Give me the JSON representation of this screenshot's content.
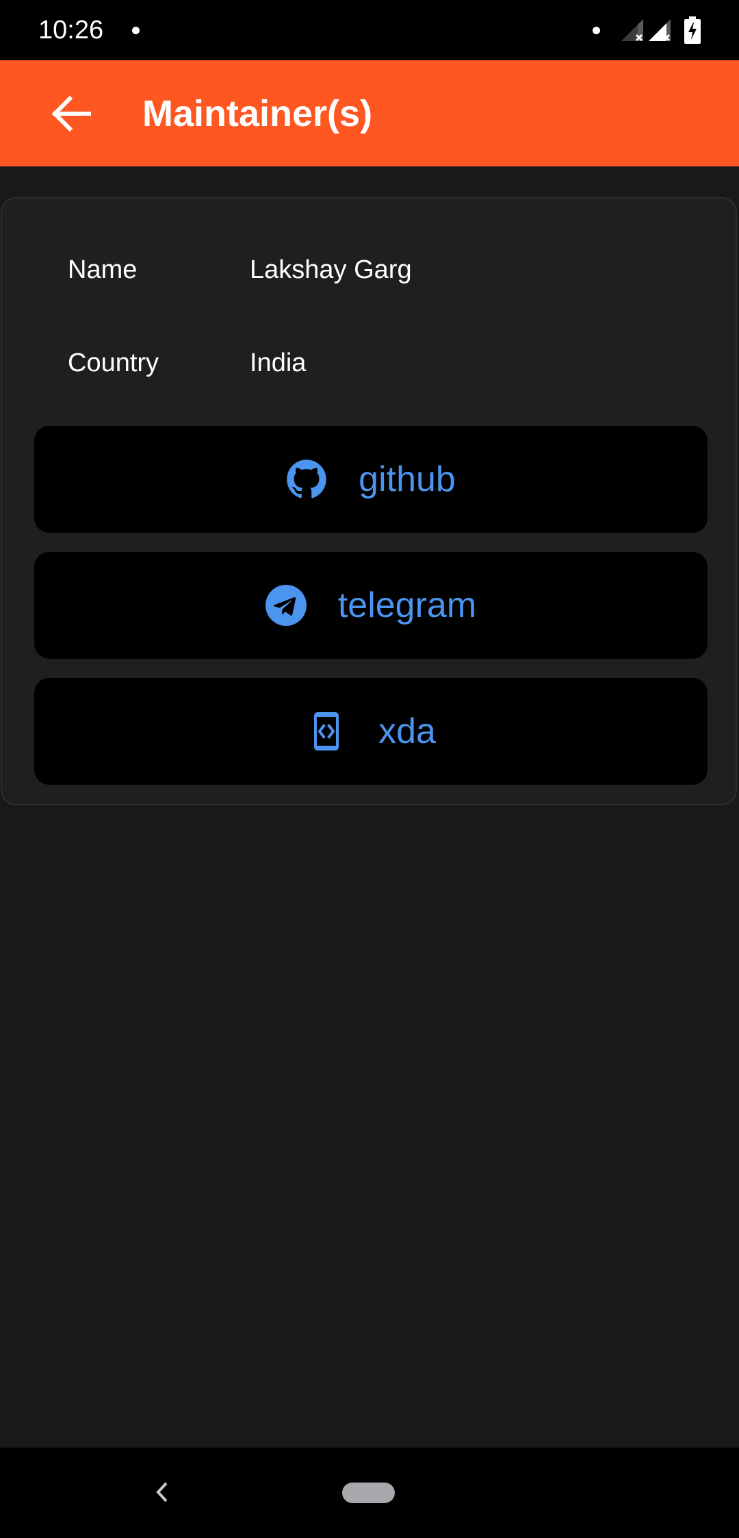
{
  "status_bar": {
    "time": "10:26"
  },
  "app_bar": {
    "title": "Maintainer(s)",
    "back_icon": "arrow-back-icon",
    "background_color": "#ff5722"
  },
  "maintainer": {
    "name_label": "Name",
    "name_value": "Lakshay Garg",
    "country_label": "Country",
    "country_value": "India"
  },
  "links": [
    {
      "label": "github",
      "icon": "github-icon"
    },
    {
      "label": "telegram",
      "icon": "telegram-icon"
    },
    {
      "label": "xda",
      "icon": "xda-icon"
    }
  ],
  "colors": {
    "accent_text": "#4b94ef",
    "background": "#18191b",
    "card": "#1f1f21"
  }
}
